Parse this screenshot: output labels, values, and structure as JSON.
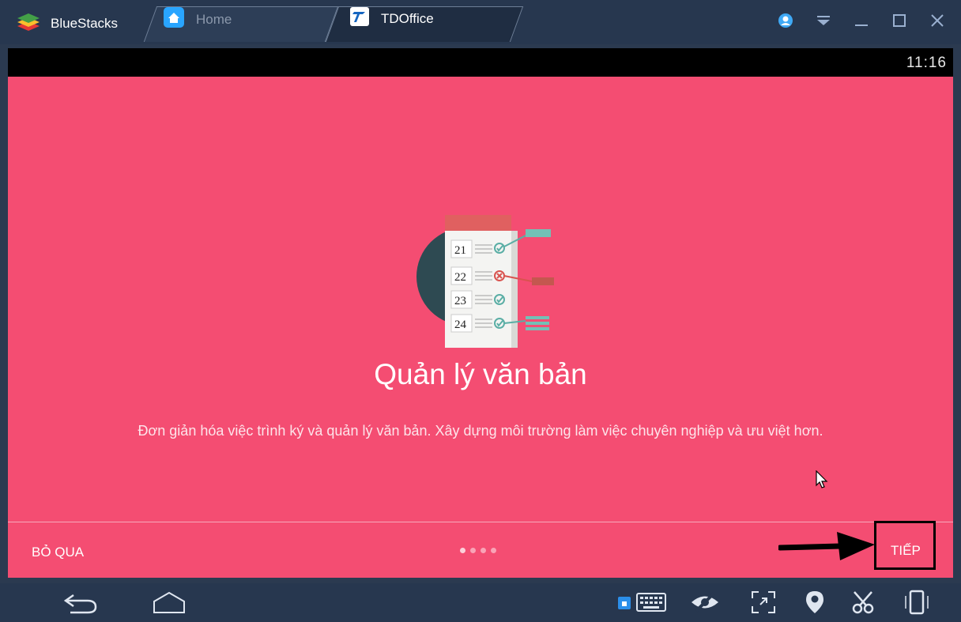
{
  "titlebar": {
    "app_name": "BlueStacks",
    "tabs": [
      {
        "label": "Home",
        "icon": "home-icon",
        "active": false
      },
      {
        "label": "TDOffice",
        "icon": "tdoffice-icon",
        "active": true
      }
    ],
    "controls": [
      "account-icon",
      "menu-dropdown-icon",
      "minimize-icon",
      "maximize-icon",
      "close-icon"
    ]
  },
  "statusbar": {
    "time": "11:16"
  },
  "onboarding": {
    "illustration_rows": [
      "21",
      "22",
      "23",
      "24"
    ],
    "title": "Quản lý văn bản",
    "description": "Đơn giản hóa việc trình ký và quản lý văn bản. Xây dựng môi trường làm việc chuyên nghiệp và ưu việt hơn.",
    "skip_label": "BỎ QUA",
    "next_label": "TIẾP",
    "page_count": 4,
    "current_page": 1
  },
  "colors": {
    "background": "#f44d72",
    "chrome": "#27374f"
  },
  "navbar": {
    "icons": [
      "back-icon",
      "home-icon",
      "keyboard-icon",
      "visibility-icon",
      "fullscreen-icon",
      "location-icon",
      "cut-icon",
      "rotate-device-icon"
    ]
  }
}
